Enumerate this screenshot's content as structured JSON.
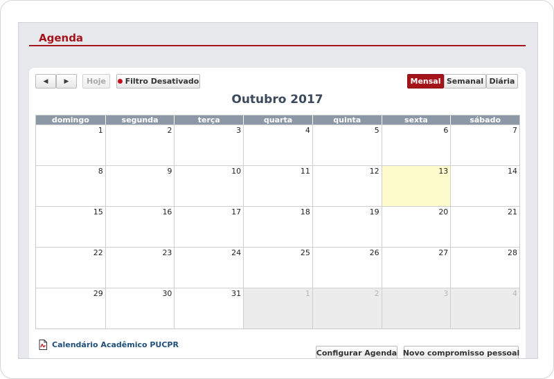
{
  "page": {
    "title": "Agenda"
  },
  "toolbar": {
    "prev_icon": "left-arrow-icon",
    "next_icon": "right-arrow-icon",
    "today_label": "Hoje",
    "filter_label": "Filtro Desativado",
    "views": {
      "month": "Mensal",
      "week": "Semanal",
      "day": "Diária",
      "active": "Mensal"
    }
  },
  "calendar": {
    "month_title": "Outubro 2017",
    "weekdays": [
      "domingo",
      "segunda",
      "terça",
      "quarta",
      "quinta",
      "sexta",
      "sábado"
    ],
    "weeks": [
      [
        {
          "n": "1"
        },
        {
          "n": "2"
        },
        {
          "n": "3"
        },
        {
          "n": "4"
        },
        {
          "n": "5"
        },
        {
          "n": "6"
        },
        {
          "n": "7"
        }
      ],
      [
        {
          "n": "8"
        },
        {
          "n": "9"
        },
        {
          "n": "10"
        },
        {
          "n": "11"
        },
        {
          "n": "12"
        },
        {
          "n": "13",
          "today": true
        },
        {
          "n": "14"
        }
      ],
      [
        {
          "n": "15"
        },
        {
          "n": "16"
        },
        {
          "n": "17"
        },
        {
          "n": "18"
        },
        {
          "n": "19"
        },
        {
          "n": "20"
        },
        {
          "n": "21"
        }
      ],
      [
        {
          "n": "22"
        },
        {
          "n": "23"
        },
        {
          "n": "24"
        },
        {
          "n": "25"
        },
        {
          "n": "26"
        },
        {
          "n": "27"
        },
        {
          "n": "28"
        }
      ],
      [
        {
          "n": "29"
        },
        {
          "n": "30"
        },
        {
          "n": "31"
        },
        {
          "n": "1",
          "other": true
        },
        {
          "n": "2",
          "other": true
        },
        {
          "n": "3",
          "other": true
        },
        {
          "n": "4",
          "other": true
        }
      ]
    ]
  },
  "footer": {
    "pdf_link": "Calendário Acadêmico PUCPR",
    "configure_button": "Configurar Agenda",
    "new_button": "Novo compromisso pessoal"
  },
  "colors": {
    "accent": "#a5131b",
    "header": "#8d98a6",
    "today": "#fefbcc"
  }
}
